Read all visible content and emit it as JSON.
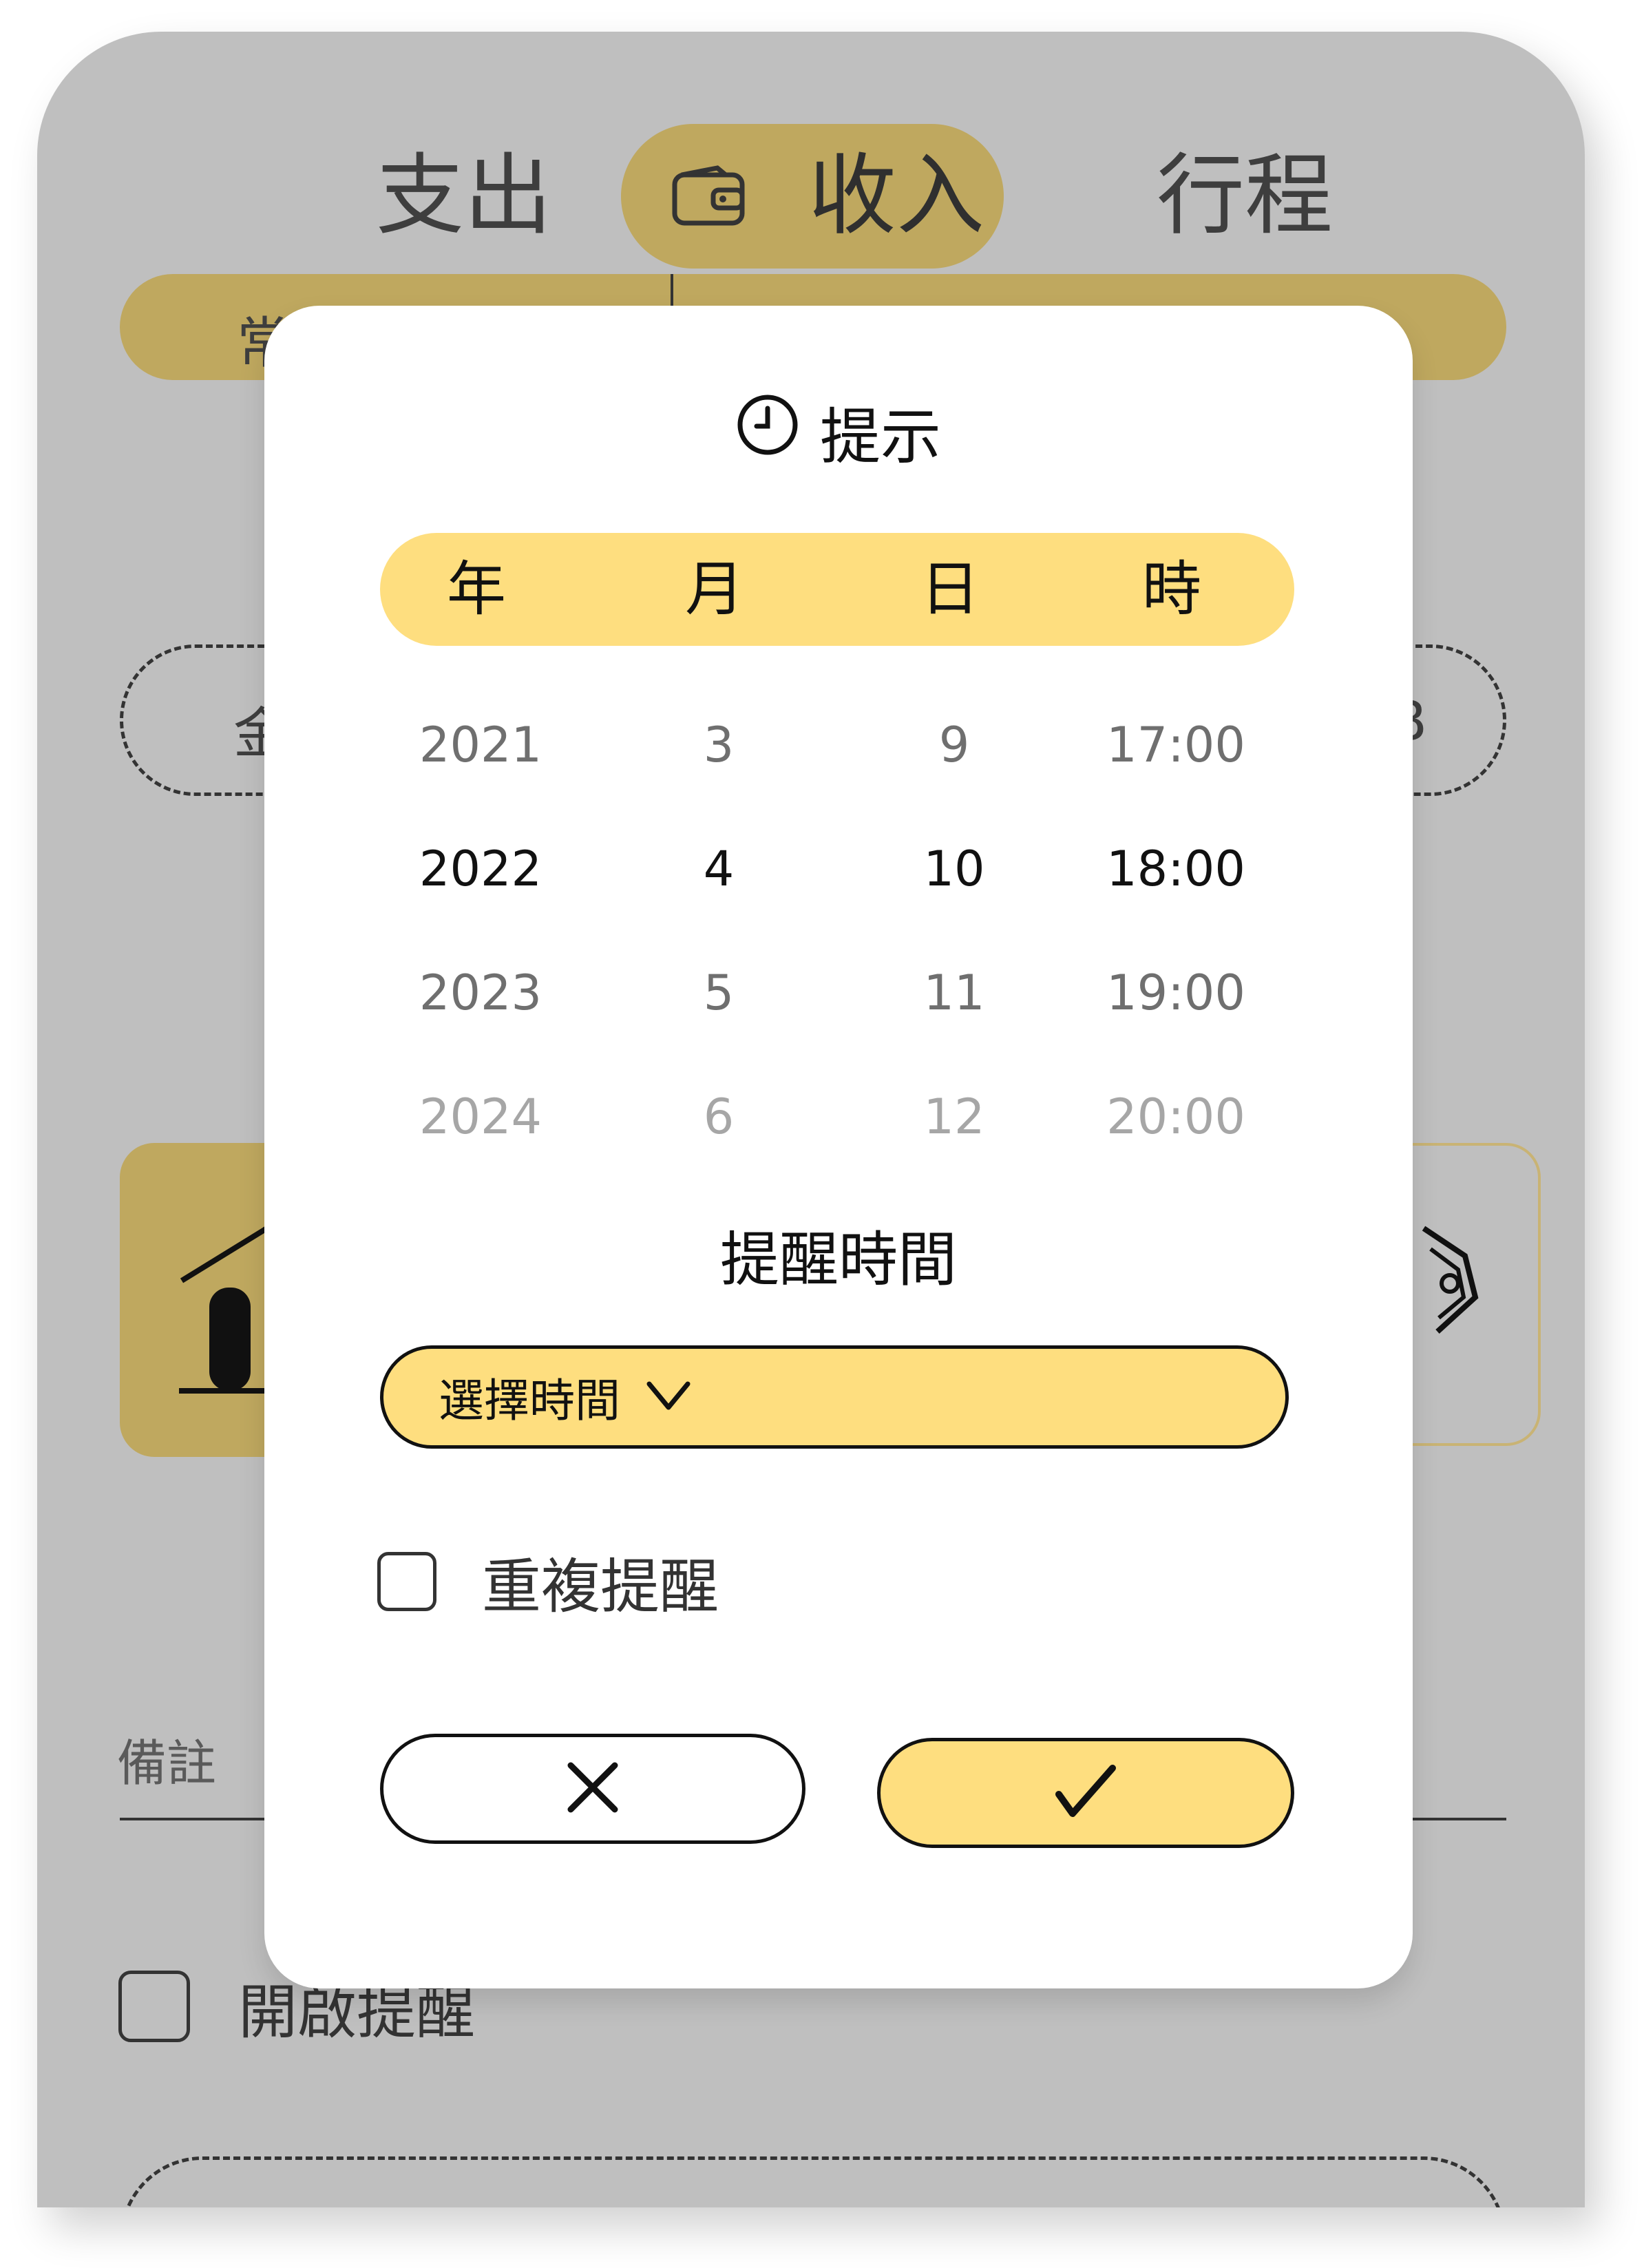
{
  "background": {
    "tabs": [
      "支出",
      "收入",
      "行程"
    ],
    "active_tab_icon": "wallet-icon",
    "sub_bar_left_text": "常",
    "dashed_left_text": "金",
    "dashed_right_text": "B",
    "note_label": "備註",
    "enable_reminder_label": "開啟提醒"
  },
  "modal": {
    "title": "提示",
    "title_icon": "clock-icon",
    "columns": [
      "年",
      "月",
      "日",
      "時"
    ],
    "rows": [
      [
        "2021",
        "3",
        "9",
        "17:00"
      ],
      [
        "2022",
        "4",
        "10",
        "18:00"
      ],
      [
        "2023",
        "5",
        "11",
        "19:00"
      ],
      [
        "2024",
        "6",
        "12",
        "20:00"
      ]
    ],
    "selected_row_index": 1,
    "reminder_time_title": "提醒時間",
    "select_time_label": "選擇時間",
    "repeat_reminder_label": "重複提醒",
    "cancel_icon": "close-icon",
    "confirm_icon": "checkmark-icon"
  },
  "colors": {
    "overlay_gray": "#bfbfbf",
    "dim_gold": "#bfa85f",
    "accent_yellow": "#fede7f",
    "text_dark": "#111111"
  }
}
